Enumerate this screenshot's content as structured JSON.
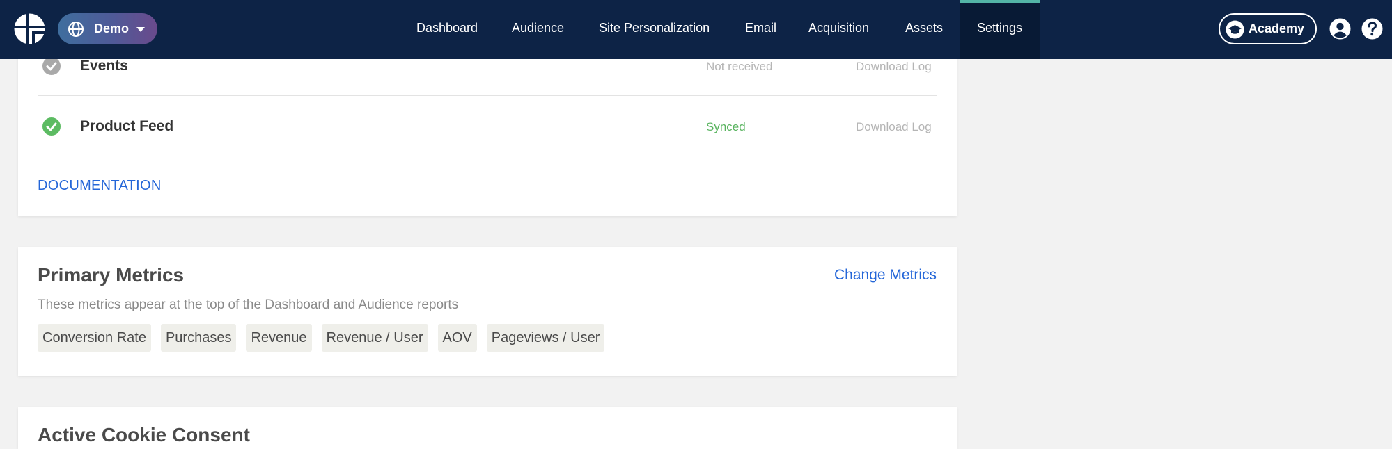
{
  "nav": {
    "workspace": "Demo",
    "items": [
      {
        "label": "Dashboard",
        "active": false
      },
      {
        "label": "Audience",
        "active": false
      },
      {
        "label": "Site Personalization",
        "active": false
      },
      {
        "label": "Email",
        "active": false
      },
      {
        "label": "Acquisition",
        "active": false
      },
      {
        "label": "Assets",
        "active": false
      },
      {
        "label": "Settings",
        "active": true
      }
    ],
    "academy_label": "Academy"
  },
  "integrations": {
    "rows": [
      {
        "name": "Events",
        "status": "Not received",
        "action": "Download Log",
        "status_icon": "check-circle-grey-icon"
      },
      {
        "name": "Product Feed",
        "status": "Synced",
        "action": "Download Log",
        "status_icon": "check-circle-green-icon"
      }
    ],
    "documentation_link": "DOCUMENTATION"
  },
  "primary_metrics": {
    "title": "Primary Metrics",
    "change_link": "Change Metrics",
    "subtitle": "These metrics appear at the top of the Dashboard and Audience reports",
    "metrics": [
      "Conversion Rate",
      "Purchases",
      "Revenue",
      "Revenue / User",
      "AOV",
      "Pageviews / User"
    ]
  },
  "cookie_consent": {
    "title": "Active Cookie Consent"
  },
  "colors": {
    "nav_bg": "#0d2346",
    "accent_link": "#2466d8",
    "success": "#58b35e",
    "active_tab_indicator": "#53b4a6"
  }
}
